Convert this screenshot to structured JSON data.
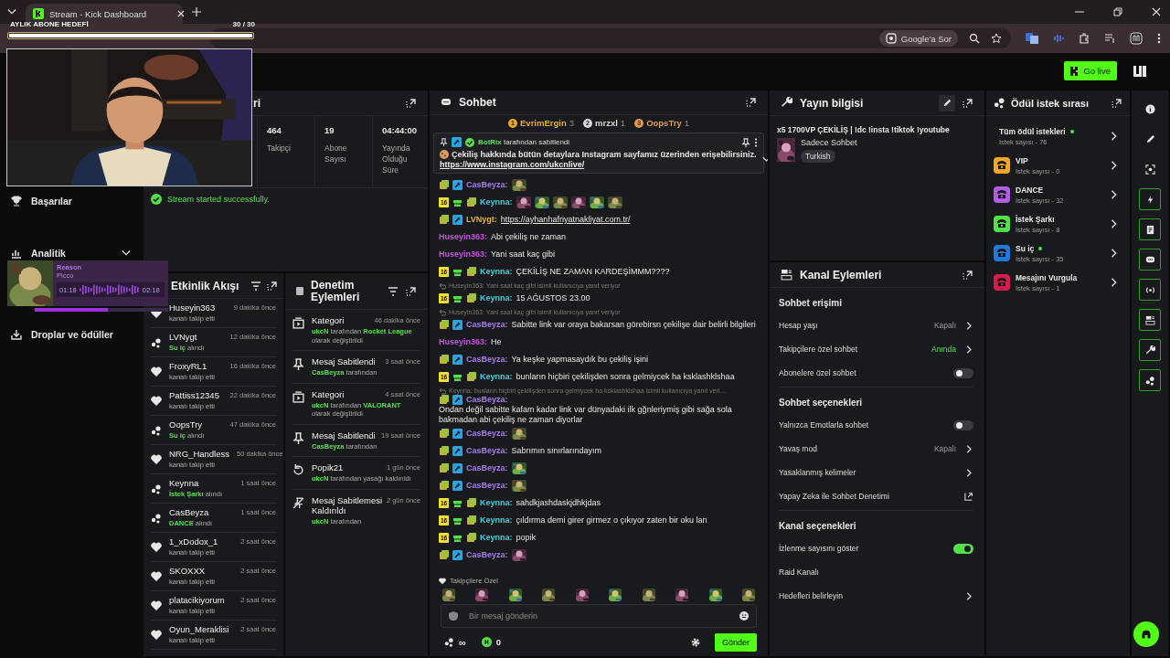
{
  "browser": {
    "tab_title": "Stream - Kick Dashboard",
    "ask_chip": "Google'a Sor"
  },
  "header": {
    "go_live": "Go live"
  },
  "overlay": {
    "goal": {
      "title": "AYLIK ABONE HEDEFİ",
      "count": "30 / 30",
      "level": 1
    },
    "webcam": {
      "kind": "picture"
    },
    "music": {
      "title": "Reason",
      "artist": "Picco",
      "elapsed": "01:18",
      "total": "02:18",
      "level": 0.55
    }
  },
  "sidebar": {
    "items": [
      {
        "kind": "trophy",
        "label": "Başarılar",
        "expandable": false
      },
      {
        "kind": "chart",
        "label": "Analitik",
        "expandable": true
      },
      {
        "kind": "drop",
        "label": "Droplar ve ödüller",
        "expandable": false
      }
    ]
  },
  "stats": {
    "title": "ri",
    "items": [
      {
        "value": "464",
        "label": "Takipçi"
      },
      {
        "value": "19",
        "label": "Abone Sayısı"
      },
      {
        "value": "04:44:00",
        "label": "Yayında Olduğu Süre"
      }
    ],
    "notice": "Stream started successfully."
  },
  "activity": {
    "title": "Etkinlik Akışı",
    "items": [
      {
        "kind": "follow",
        "name": "Huseyin363",
        "time": "9 dakika önce",
        "detail": [
          {
            "text": "kanalı takip etti",
            "highlight": false
          }
        ]
      },
      {
        "kind": "reward",
        "name": "LVNygt",
        "time": "12 dakika önce",
        "detail": [
          {
            "text": "Su iç",
            "highlight": true
          },
          {
            "text": "alındı",
            "highlight": false
          }
        ]
      },
      {
        "kind": "follow",
        "name": "FroxyRL1",
        "time": "16 dakika önce",
        "detail": [
          {
            "text": "kanalı takip etti",
            "highlight": false
          }
        ]
      },
      {
        "kind": "follow",
        "name": "Pattiss12345",
        "time": "22 dakika önce",
        "detail": [
          {
            "text": "kanalı takip etti",
            "highlight": false
          }
        ]
      },
      {
        "kind": "reward",
        "name": "OopsTry",
        "time": "47 dakika önce",
        "detail": [
          {
            "text": "Su iç",
            "highlight": true
          },
          {
            "text": "alındı",
            "highlight": false
          }
        ]
      },
      {
        "kind": "follow",
        "name": "NRG_Handless",
        "time": "50 dakika önce",
        "detail": [
          {
            "text": "kanalı takip etti",
            "highlight": false
          }
        ]
      },
      {
        "kind": "reward",
        "name": "Keynna",
        "time": "1 saat önce",
        "detail": [
          {
            "text": "İstek Şarkı",
            "highlight": true
          },
          {
            "text": "alındı",
            "highlight": false
          }
        ]
      },
      {
        "kind": "reward",
        "name": "CasBeyza",
        "time": "1 saat önce",
        "detail": [
          {
            "text": "DANCE",
            "highlight": true
          },
          {
            "text": "alındı",
            "highlight": false
          }
        ]
      },
      {
        "kind": "follow",
        "name": "1_xDodox_1",
        "time": "2 saat önce",
        "detail": [
          {
            "text": "kanalı takip etti",
            "highlight": false
          }
        ]
      },
      {
        "kind": "follow",
        "name": "SKOXXX",
        "time": "2 saat önce",
        "detail": [
          {
            "text": "kanalı takip etti",
            "highlight": false
          }
        ]
      },
      {
        "kind": "follow",
        "name": "platacikiyorum",
        "time": "2 saat önce",
        "detail": [
          {
            "text": "kanalı takip etti",
            "highlight": false
          }
        ]
      },
      {
        "kind": "follow",
        "name": "Oyun_Meraklisi",
        "time": "2 saat önce",
        "detail": [
          {
            "text": "kanalı takip etti",
            "highlight": false
          }
        ]
      }
    ]
  },
  "moderation": {
    "title": "Denetim Eylemleri",
    "items": [
      {
        "kind": "category",
        "title": "Kategori",
        "time": "46 dakika önce",
        "detail": [
          {
            "text": "ukcN",
            "highlight": true
          },
          {
            "text": "tarafından",
            "highlight": false
          },
          {
            "text": "Rocket League",
            "highlight": true
          },
          {
            "text": "olarak değiştirildi",
            "highlight": false
          }
        ]
      },
      {
        "kind": "pin",
        "title": "Mesaj Sabitlendi",
        "time": "3 saat önce",
        "detail": [
          {
            "text": "CasBeyza",
            "highlight": true
          },
          {
            "text": "tarafından",
            "highlight": false
          }
        ]
      },
      {
        "kind": "category",
        "title": "Kategori",
        "time": "4 saat önce",
        "detail": [
          {
            "text": "ukcN",
            "highlight": true
          },
          {
            "text": "tarafından",
            "highlight": false
          },
          {
            "text": "VALORANT",
            "highlight": true
          },
          {
            "text": "olarak değiştirildi",
            "highlight": false
          }
        ]
      },
      {
        "kind": "pin",
        "title": "Mesaj Sabitlendi",
        "time": "19 saat önce",
        "detail": [
          {
            "text": "CasBeyza",
            "highlight": true
          },
          {
            "text": "tarafından",
            "highlight": false
          }
        ]
      },
      {
        "kind": "unban",
        "title": "Popik21",
        "time": "1 gün önce",
        "detail": [
          {
            "text": "ukcN",
            "highlight": true
          },
          {
            "text": "tarafından yasağı kaldırıldı",
            "highlight": false
          }
        ]
      },
      {
        "kind": "unpin",
        "title": "Mesaj Sabitlemesi Kaldırıldı",
        "time": "2 gün önce",
        "detail": [
          {
            "text": "ukcN",
            "highlight": true
          },
          {
            "text": "tarafından",
            "highlight": false
          }
        ]
      }
    ]
  },
  "chat": {
    "title": "Sohbet",
    "leaders": [
      {
        "rank": "1",
        "name": "EvrimErgin",
        "count": "3",
        "color": "#e8a92c"
      },
      {
        "rank": "2",
        "name": "mrzxl",
        "count": "1",
        "color": "#d8d8d8"
      },
      {
        "rank": "3",
        "name": "OopsTry",
        "count": "1",
        "color": "#e09a4a"
      }
    ],
    "pinned": {
      "user": "BotRix",
      "note": "tarafından sabitlendi",
      "text": "Çekiliş hakkında bütün detaylara Instagram sayfamız üzerinden erişebilirsiniz.",
      "link": "https://www.instagram.com/ukcnlive/"
    },
    "messages": [
      {
        "badges": [
          {
            "kind": "stack"
          },
          {
            "kind": "mod"
          }
        ],
        "user": "CasBeyza:",
        "color": "#a77be8",
        "emotes": [
          {
            "kind": "picture"
          }
        ]
      },
      {
        "badges": [
          {
            "kind": "sub",
            "text": "16"
          },
          {
            "kind": "gift"
          },
          {
            "kind": "stack"
          }
        ],
        "user": "Keynna:",
        "color": "#3fd0d8",
        "emotes": [
          {
            "kind": "picture"
          },
          {
            "kind": "picture"
          },
          {
            "kind": "picture"
          },
          {
            "kind": "picture"
          },
          {
            "kind": "picture"
          },
          {
            "kind": "picture"
          }
        ]
      },
      {
        "badges": [
          {
            "kind": "stack"
          },
          {
            "kind": "mod"
          }
        ],
        "user": "LVNygt:",
        "color": "#e2b53a",
        "link": "https://ayhanhafriyatnakliyat.com.tr/"
      },
      {
        "user": "Huseyin363:",
        "color": "#c94fe0",
        "text": "Abi çekiliş ne zaman"
      },
      {
        "user": "Huseyin363:",
        "color": "#c94fe0",
        "text": "Yani saat kaç gibi"
      },
      {
        "badges": [
          {
            "kind": "sub",
            "text": "16"
          },
          {
            "kind": "gift"
          },
          {
            "kind": "stack"
          }
        ],
        "user": "Keynna:",
        "color": "#3fd0d8",
        "text": "ÇEKİLİŞ NE ZAMAN KARDEŞİMMM????"
      },
      {
        "reply": "Huseyin363: Yani saat kaç gibi isimli kullanıcıya yanıt veriyor",
        "badges": [
          {
            "kind": "sub",
            "text": "16"
          },
          {
            "kind": "gift"
          },
          {
            "kind": "stack"
          }
        ],
        "user": "Keynna:",
        "color": "#3fd0d8",
        "text": "15 AĞUSTOS 23.00"
      },
      {
        "reply": "Huseyin363: Yani saat kaç gibi isimli kullanıcıya yanıt veriyor",
        "badges": [
          {
            "kind": "stack"
          },
          {
            "kind": "mod"
          }
        ],
        "user": "CasBeyza:",
        "color": "#a77be8",
        "text": "Sabitte link var oraya bakarsan görebirsn çekilişe dair belirli bilgileri"
      },
      {
        "user": "Huseyin363:",
        "color": "#c94fe0",
        "text": "He"
      },
      {
        "badges": [
          {
            "kind": "stack"
          },
          {
            "kind": "mod"
          }
        ],
        "user": "CasBeyza:",
        "color": "#a77be8",
        "text": "Ya keşke yapmasaydık bu çekiliş işini"
      },
      {
        "badges": [
          {
            "kind": "sub",
            "text": "16"
          },
          {
            "kind": "gift"
          },
          {
            "kind": "stack"
          }
        ],
        "user": "Keynna:",
        "color": "#3fd0d8",
        "text": "bunların hiçbiri çekilişden sonra gelmiycek ha ksklashklshaa"
      },
      {
        "reply": "Keynna: bunların hiçbiri çekilişden sonra gelmiycek ha ksklashklshaa isimli kullanıcıya yanıt veri…",
        "badges": [
          {
            "kind": "stack"
          },
          {
            "kind": "mod"
          }
        ],
        "user": "CasBeyza:",
        "color": "#a77be8",
        "text": "Ondan değil sabitte kafam kadar link var dünyadaki ilk gğnleriymiş gibi sağa sola bakmadan abi çekiliş ne zaman diyorlar"
      },
      {
        "badges": [
          {
            "kind": "stack"
          },
          {
            "kind": "mod"
          }
        ],
        "user": "CasBeyza:",
        "color": "#a77be8",
        "emotes": [
          {
            "kind": "picture"
          }
        ]
      },
      {
        "badges": [
          {
            "kind": "stack"
          },
          {
            "kind": "mod"
          }
        ],
        "user": "CasBeyza:",
        "color": "#a77be8",
        "text": "Sabrımın sınırlarındayım"
      },
      {
        "badges": [
          {
            "kind": "stack"
          },
          {
            "kind": "mod"
          }
        ],
        "user": "CasBeyza:",
        "color": "#a77be8",
        "emotes": [
          {
            "kind": "picture"
          }
        ]
      },
      {
        "badges": [
          {
            "kind": "stack"
          },
          {
            "kind": "mod"
          }
        ],
        "user": "CasBeyza:",
        "color": "#a77be8",
        "emotes": [
          {
            "kind": "picture"
          }
        ]
      },
      {
        "badges": [
          {
            "kind": "sub",
            "text": "16"
          },
          {
            "kind": "gift"
          },
          {
            "kind": "stack"
          }
        ],
        "user": "Keynna:",
        "color": "#3fd0d8",
        "text": "sahdkjashdaskjdhkjdas"
      },
      {
        "badges": [
          {
            "kind": "sub",
            "text": "16"
          },
          {
            "kind": "gift"
          },
          {
            "kind": "stack"
          }
        ],
        "user": "Keynna:",
        "color": "#3fd0d8",
        "text": "çıldırma demi girer girmez o çıkıyor zaten bir oku lan"
      },
      {
        "badges": [
          {
            "kind": "sub",
            "text": "16"
          },
          {
            "kind": "gift"
          },
          {
            "kind": "stack"
          }
        ],
        "user": "Keynna:",
        "color": "#3fd0d8",
        "text": "popik"
      },
      {
        "badges": [
          {
            "kind": "stack"
          },
          {
            "kind": "mod"
          }
        ],
        "user": "CasBeyza:",
        "color": "#a77be8",
        "emotes": [
          {
            "kind": "picture"
          }
        ]
      }
    ],
    "emote_section": "Takipçilere Özel",
    "emote_row": [
      {
        "kind": "picture"
      },
      {
        "kind": "picture"
      },
      {
        "kind": "picture"
      },
      {
        "kind": "picture"
      },
      {
        "kind": "picture"
      },
      {
        "kind": "picture"
      },
      {
        "kind": "picture"
      },
      {
        "kind": "picture"
      },
      {
        "kind": "picture"
      },
      {
        "kind": "picture"
      }
    ],
    "input": {
      "placeholder": "Bir mesaj gönderin"
    },
    "points": "∞",
    "coins": "0",
    "send": "Gönder"
  },
  "stream_info": {
    "title": "Yayın bilgisi",
    "stream_title": "x5 1700VP ÇEKİLİŞ | !dc !insta !tiktok !youtube",
    "category": "Sadece Sohbet",
    "tag": "Turkish"
  },
  "channel_actions": {
    "title": "Kanal Eylemleri",
    "sections": [
      {
        "title": "Sohbet erişimi",
        "rows": [
          {
            "kind": "value",
            "label": "Hesap yaşı",
            "value": "Kapalı",
            "highlight": false
          },
          {
            "kind": "value",
            "label": "Takipçilere özel sohbet",
            "value": "Anında",
            "highlight": true
          },
          {
            "kind": "toggle",
            "label": "Abonelere özel sohbet",
            "on": false
          }
        ]
      },
      {
        "title": "Sohbet seçenekleri",
        "rows": [
          {
            "kind": "toggle",
            "label": "Yalnızca Emotlarla sohbet",
            "on": false
          },
          {
            "kind": "value",
            "label": "Yavaş mod",
            "value": "Kapalı",
            "highlight": false
          },
          {
            "kind": "link",
            "label": "Yasaklanmış kelimeler"
          },
          {
            "kind": "external",
            "label": "Yapay Zeka ile Sohbet Denetimi"
          }
        ]
      },
      {
        "title": "Kanal seçenekleri",
        "rows": [
          {
            "kind": "toggle",
            "label": "İzlenme sayısını göster",
            "on": true
          },
          {
            "kind": "plain",
            "label": "Raid Kanalı"
          },
          {
            "kind": "link",
            "label": "Hedefleri belirleyin"
          }
        ]
      }
    ]
  },
  "reward_queue": {
    "title": "Ödül istek sırası",
    "items": [
      {
        "kind": "all",
        "title": "Tüm ödül istekleri",
        "count": "İstek sayısı - 76",
        "active": true
      },
      {
        "kind": "reward",
        "title": "VIP",
        "count": "İstek sayısı - 0",
        "color": "#f5a623",
        "active": false
      },
      {
        "kind": "reward",
        "title": "DANCE",
        "count": "İstek sayısı - 32",
        "color": "#b05ce6",
        "active": false
      },
      {
        "kind": "reward",
        "title": "İstek Şarkı",
        "count": "İstek sayısı - 8",
        "color": "#53e04a",
        "active": false
      },
      {
        "kind": "reward",
        "title": "Su iç",
        "count": "İstek sayısı - 35",
        "color": "#1f7ae0",
        "active": true
      },
      {
        "kind": "reward",
        "title": "Mesajını Vurgula",
        "count": "İstek sayısı - 1",
        "color": "#d81b4a",
        "active": false
      }
    ]
  },
  "rail": [
    {
      "kind": "info",
      "on": false
    },
    {
      "kind": "edit",
      "on": false
    },
    {
      "kind": "focus",
      "on": false
    },
    {
      "kind": "bolt",
      "on": true
    },
    {
      "kind": "doc",
      "on": true
    },
    {
      "kind": "chat",
      "on": true
    },
    {
      "kind": "broadcast",
      "on": true
    },
    {
      "kind": "layout",
      "on": true
    },
    {
      "kind": "wrench",
      "on": true
    },
    {
      "kind": "coins",
      "on": true
    }
  ]
}
